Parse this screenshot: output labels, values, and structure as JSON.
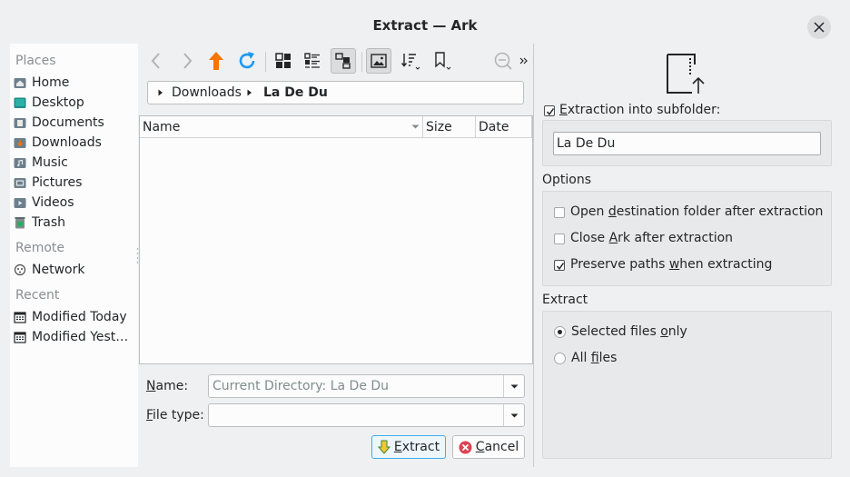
{
  "window": {
    "title": "Extract — Ark"
  },
  "places": {
    "sections": {
      "places": "Places",
      "remote": "Remote",
      "recent": "Recent"
    },
    "items": [
      {
        "label": "Home",
        "icon": "home-folder-icon"
      },
      {
        "label": "Desktop",
        "icon": "desktop-folder-icon"
      },
      {
        "label": "Documents",
        "icon": "documents-folder-icon"
      },
      {
        "label": "Downloads",
        "icon": "downloads-folder-icon"
      },
      {
        "label": "Music",
        "icon": "music-folder-icon"
      },
      {
        "label": "Pictures",
        "icon": "pictures-folder-icon"
      },
      {
        "label": "Videos",
        "icon": "videos-folder-icon"
      },
      {
        "label": "Trash",
        "icon": "trash-icon"
      }
    ],
    "remote_items": [
      {
        "label": "Network",
        "icon": "network-icon"
      }
    ],
    "recent_items": [
      {
        "label": "Modified Today",
        "icon": "calendar-icon"
      },
      {
        "label": "Modified Yesterday",
        "icon": "calendar-icon"
      }
    ]
  },
  "breadcrumb": {
    "segments": [
      "Downloads",
      "La De Du"
    ]
  },
  "filelist": {
    "columns": [
      "Name",
      "Size",
      "Date"
    ],
    "rows": []
  },
  "form": {
    "name_label": "Name:",
    "name_value": "Current Directory: La De Du",
    "filetype_label": "File type:",
    "filetype_value": "",
    "extract_button": "Extract",
    "cancel_button": "Cancel"
  },
  "options_panel": {
    "subfolder_label": "Extraction into subfolder:",
    "subfolder_checked": true,
    "subfolder_value": "La De Du",
    "options_header": "Options",
    "options": [
      {
        "label": "Open destination folder after extraction",
        "checked": false
      },
      {
        "label": "Close Ark after extraction",
        "checked": false
      },
      {
        "label": "Preserve paths when extracting",
        "checked": true
      }
    ],
    "extract_header": "Extract",
    "extract_modes": [
      {
        "label": "Selected files only",
        "selected": true
      },
      {
        "label": "All files",
        "selected": false
      }
    ]
  },
  "colors": {
    "accent": "#3daee9",
    "orange": "#f67400",
    "blue": "#1d99f3",
    "window_bg": "#eff0f1"
  }
}
